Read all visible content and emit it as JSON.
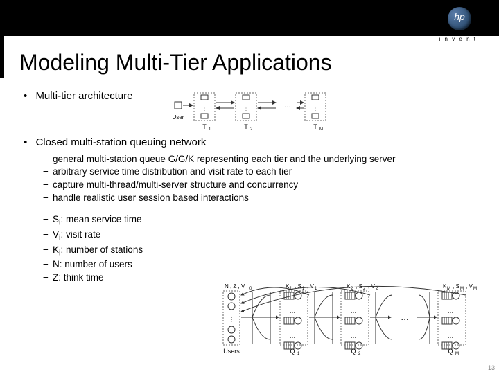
{
  "logo": {
    "brand": "hp",
    "tagline": "i n v e n t"
  },
  "title": "Modeling Multi-Tier Applications",
  "bullets": {
    "b1": "Multi-tier architecture",
    "b2": "Closed multi-station queuing network"
  },
  "sub1": {
    "s1": "general multi-station queue G/G/K representing each tier and the underlying server",
    "s2": "arbitrary service time distribution and visit rate to each tier",
    "s3": "capture multi-thread/multi-server structure and concurrency",
    "s4": "handle realistic user session based interactions"
  },
  "sub2": {
    "s1_pre": "S",
    "s1_sub": "i",
    "s1_post": ": mean service time",
    "s2_pre": "V",
    "s2_sub": "i",
    "s2_post": ": visit rate",
    "s3_pre": "K",
    "s3_sub": "i",
    "s3_post": ": number of stations",
    "s4": "N: number of users",
    "s5": "Z: think time"
  },
  "fig1": {
    "user": "User",
    "t1": "T",
    "t2": "T",
    "tm": "T",
    "t1s": "1",
    "t2s": "2",
    "tms": "M"
  },
  "fig2": {
    "n": "N",
    "z": "Z",
    "v0": "V",
    "v0s": "0",
    "k": "K",
    "s": "S",
    "v": "V",
    "i1": "1",
    "i2": "2",
    "im": "M",
    "users": "Users",
    "q": "Q"
  },
  "pagenum": "13",
  "dotglyph": "•",
  "dashglyph": "−",
  "ellipsis": ". . ."
}
